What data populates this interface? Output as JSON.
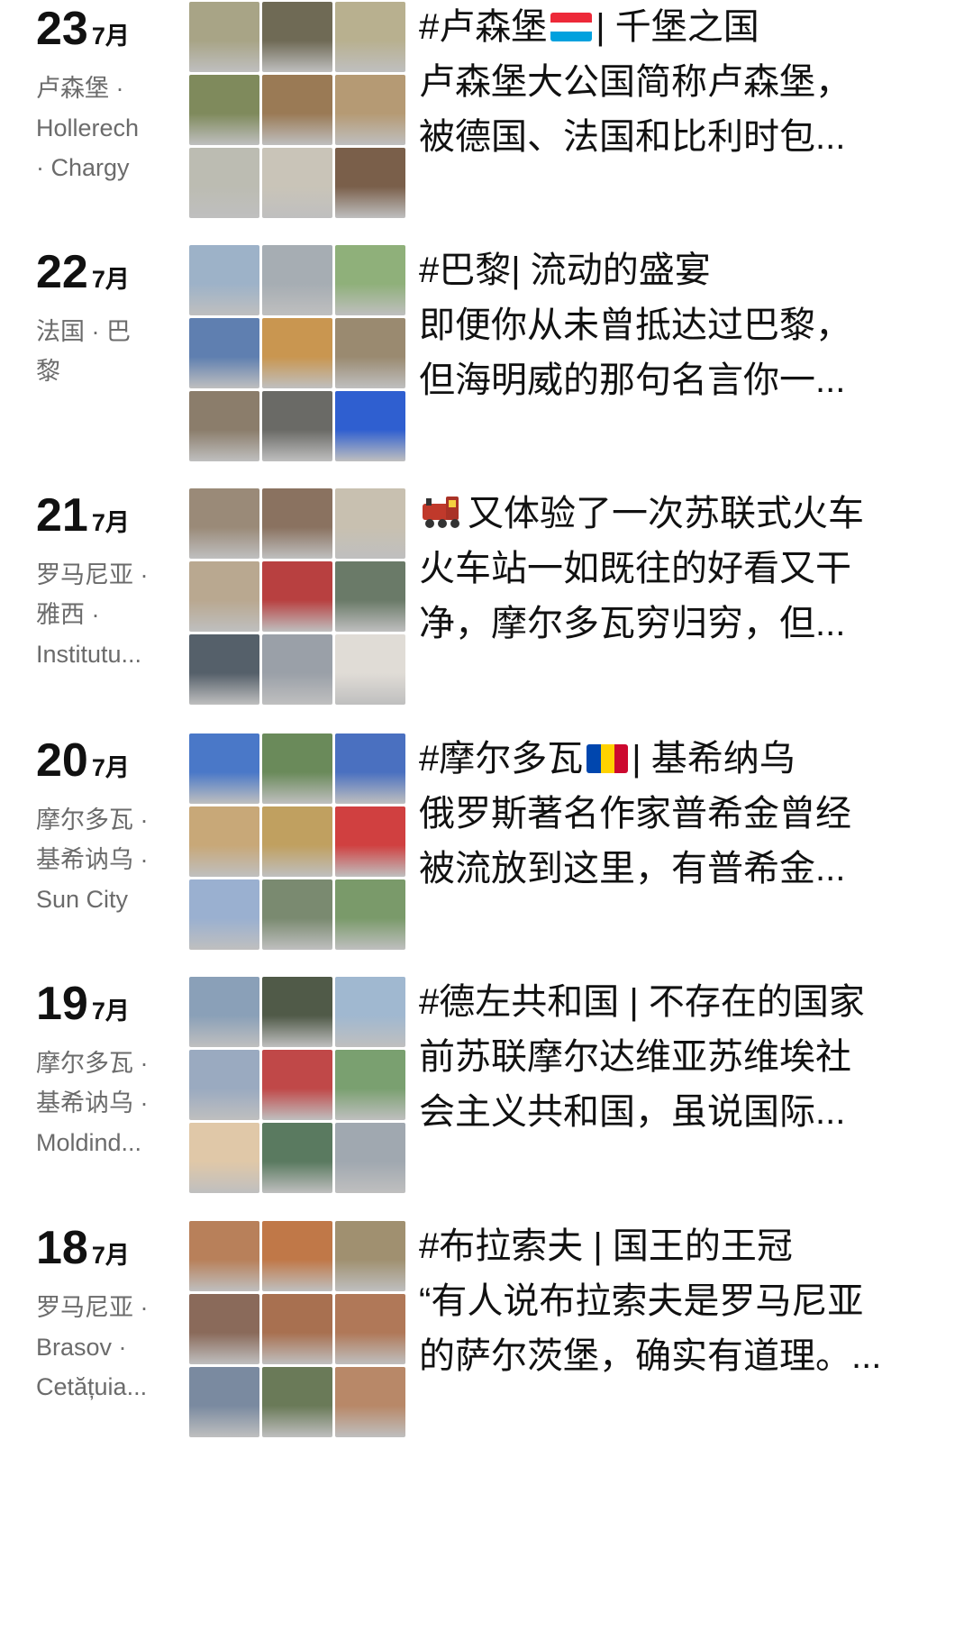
{
  "posts": [
    {
      "day": "23",
      "month": "7月",
      "location": [
        "卢森堡 ·",
        "Hollerech",
        "· Chargy"
      ],
      "title_pre": "#卢森堡",
      "flag": "luxembourg-flag-icon",
      "title_post": "| 千堡之国",
      "line2": "卢森堡大公国简称卢森堡，",
      "line3": "被德国、法国和比利时包...",
      "photos": [
        "#a8a486",
        "#6f6a55",
        "#b8b08f",
        "#7f8a5c",
        "#9a7a55",
        "#b59a74",
        "#bcbcb2",
        "#c9c4b8",
        "#7a5f4a"
      ]
    },
    {
      "day": "22",
      "month": "7月",
      "location": [
        "法国 · 巴",
        "黎"
      ],
      "title_pre": "#巴黎",
      "flag": "",
      "title_post": "| 流动的盛宴",
      "line2": "即便你从未曾抵达过巴黎，",
      "line3": "但海明威的那句名言你一...",
      "photos": [
        "#9db2c8",
        "#a6adb3",
        "#8fb07a",
        "#5f7fb0",
        "#c99650",
        "#9a8a70",
        "#8b7d6b",
        "#6a6a66",
        "#2f5fd0"
      ]
    },
    {
      "day": "21",
      "month": "7月",
      "location": [
        "罗马尼亚 ·",
        "雅西 ·",
        "Institutu..."
      ],
      "title_icon": "train-icon",
      "title_pre": "又体验了一次苏联式火车",
      "flag": "",
      "title_post": "",
      "line2": "火车站一如既往的好看又干",
      "line3": "净，摩尔多瓦穷归穷，但...",
      "photos": [
        "#9a8a78",
        "#8a7260",
        "#c8c0b0",
        "#b9a890",
        "#b84040",
        "#6a7a68",
        "#55606a",
        "#9aa0a8",
        "#e0dcd6"
      ]
    },
    {
      "day": "20",
      "month": "7月",
      "location": [
        "摩尔多瓦 ·",
        "基希讷乌 ·",
        "Sun City"
      ],
      "title_pre": "#摩尔多瓦",
      "flag": "moldova-flag-icon",
      "title_post": "| 基希纳乌",
      "line2": "俄罗斯著名作家普希金曾经",
      "line3": "被流放到这里，有普希金...",
      "photos": [
        "#4a78c8",
        "#6a8a5a",
        "#4a70c0",
        "#c8a878",
        "#c0a060",
        "#d04040",
        "#9ab0d0",
        "#7a8a70",
        "#7a9a6a"
      ]
    },
    {
      "day": "19",
      "month": "7月",
      "location": [
        "摩尔多瓦 ·",
        "基希讷乌 ·",
        "Moldind..."
      ],
      "title_pre": "#德左共和国 | 不存在的国家",
      "flag": "",
      "title_post": "",
      "line2": "前苏联摩尔达维亚苏维埃社",
      "line3": "会主义共和国，虽说国际...",
      "photos": [
        "#8aa0b8",
        "#505a48",
        "#a0b8d0",
        "#9aaac0",
        "#c04848",
        "#7aa070",
        "#e0c8a8",
        "#5a7a60",
        "#a0a8b0"
      ]
    },
    {
      "day": "18",
      "month": "7月",
      "location": [
        "罗马尼亚 ·",
        "Brasov ·",
        "Cetățuia..."
      ],
      "title_pre": "#布拉索夫 | 国王的王冠",
      "flag": "",
      "title_post": "",
      "line2": "“有人说布拉索夫是罗马尼亚",
      "line3": "的萨尔茨堡，确实有道理。...",
      "photos": [
        "#b8805a",
        "#c07848",
        "#a09070",
        "#8a6a5a",
        "#a87050",
        "#b07858",
        "#7a8aa0",
        "#6a7a58",
        "#b88868"
      ]
    }
  ]
}
